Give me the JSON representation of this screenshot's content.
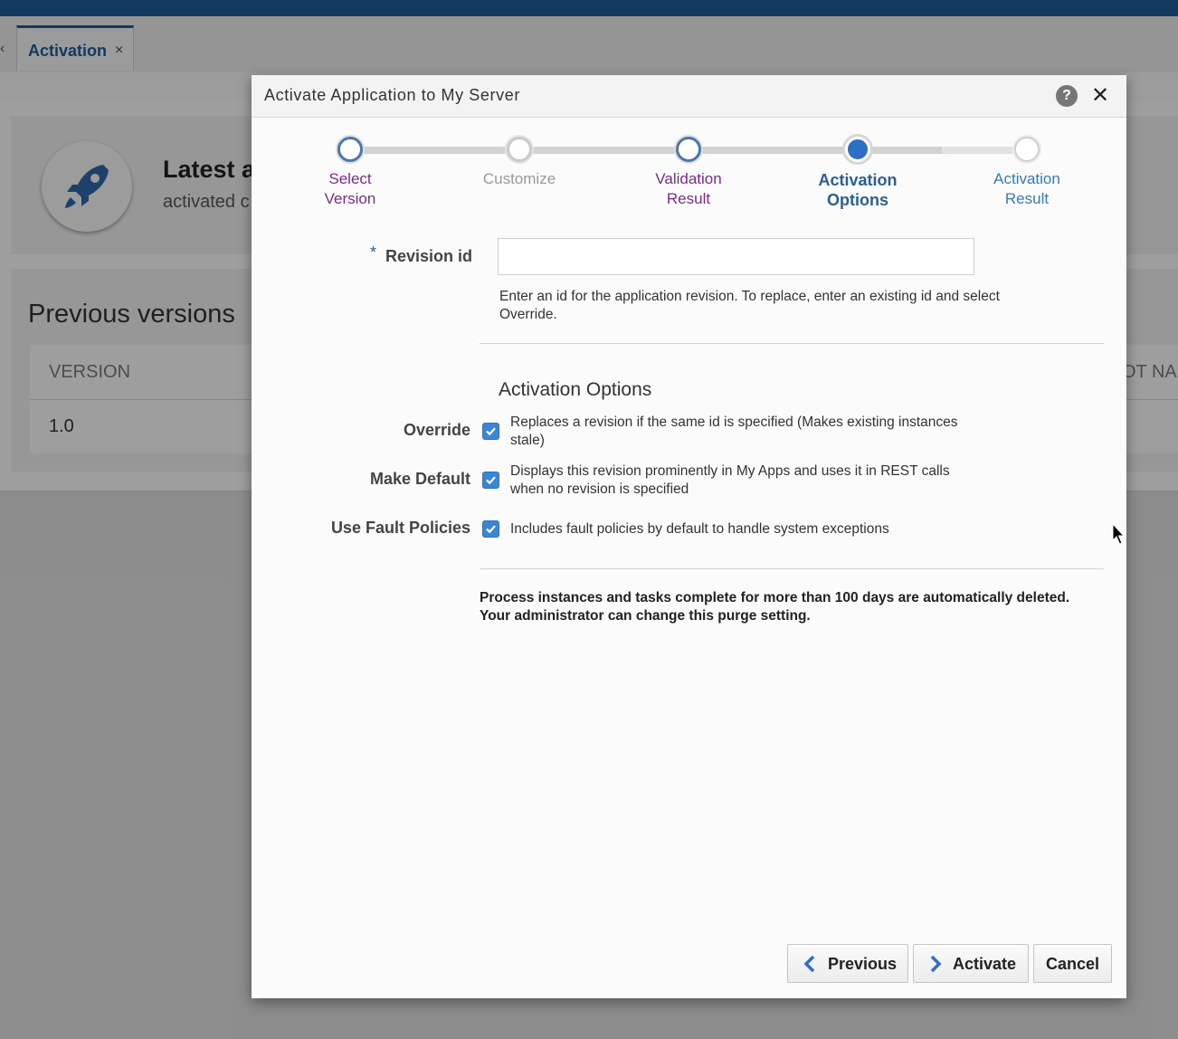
{
  "background": {
    "tab_label": "Activation",
    "tab_close": "×",
    "tab_back_glyph": "‹",
    "latest_title": "Latest a",
    "latest_subtitle": "activated c",
    "previous_title": "Previous versions",
    "table_header": "VERSION",
    "table_header_right": "OT NA",
    "table_row_version": "1.0"
  },
  "dialog": {
    "title": "Activate Application to My Server",
    "help_glyph": "?",
    "close_glyph": "✕",
    "steps": [
      {
        "line1": "Select",
        "line2": "Version",
        "state": "visited"
      },
      {
        "line1": "Customize",
        "line2": "",
        "state": "disabled"
      },
      {
        "line1": "Validation",
        "line2": "Result",
        "state": "visited"
      },
      {
        "line1": "Activation",
        "line2": "Options",
        "state": "current"
      },
      {
        "line1": "Activation",
        "line2": "Result",
        "state": "unvisited"
      }
    ],
    "required_mark": "*",
    "revision_label": "Revision id",
    "revision_value": "",
    "revision_help": "Enter an id for the application revision. To replace, enter an existing id and select Override.",
    "section_title": "Activation Options",
    "options": {
      "override": {
        "label": "Override",
        "checked": true,
        "desc": "Replaces a revision if the same id is specified (Makes existing instances stale)"
      },
      "make_default": {
        "label": "Make Default",
        "checked": true,
        "desc": "Displays this revision prominently in My Apps and uses it in REST calls when no revision is specified"
      },
      "fault_policies": {
        "label": "Use Fault Policies",
        "checked": true,
        "desc": "Includes fault policies by default to handle system exceptions"
      }
    },
    "purge_note": "Process instances and tasks complete for more than 100 days are automatically deleted. Your administrator can change this purge setting.",
    "buttons": {
      "previous": "Previous",
      "activate": "Activate",
      "cancel": "Cancel"
    }
  },
  "colors": {
    "brand_blue": "#1f5a96",
    "current_step": "#2d6fc4",
    "visited_label": "#7a2d86",
    "checkbox": "#3a86d4"
  }
}
